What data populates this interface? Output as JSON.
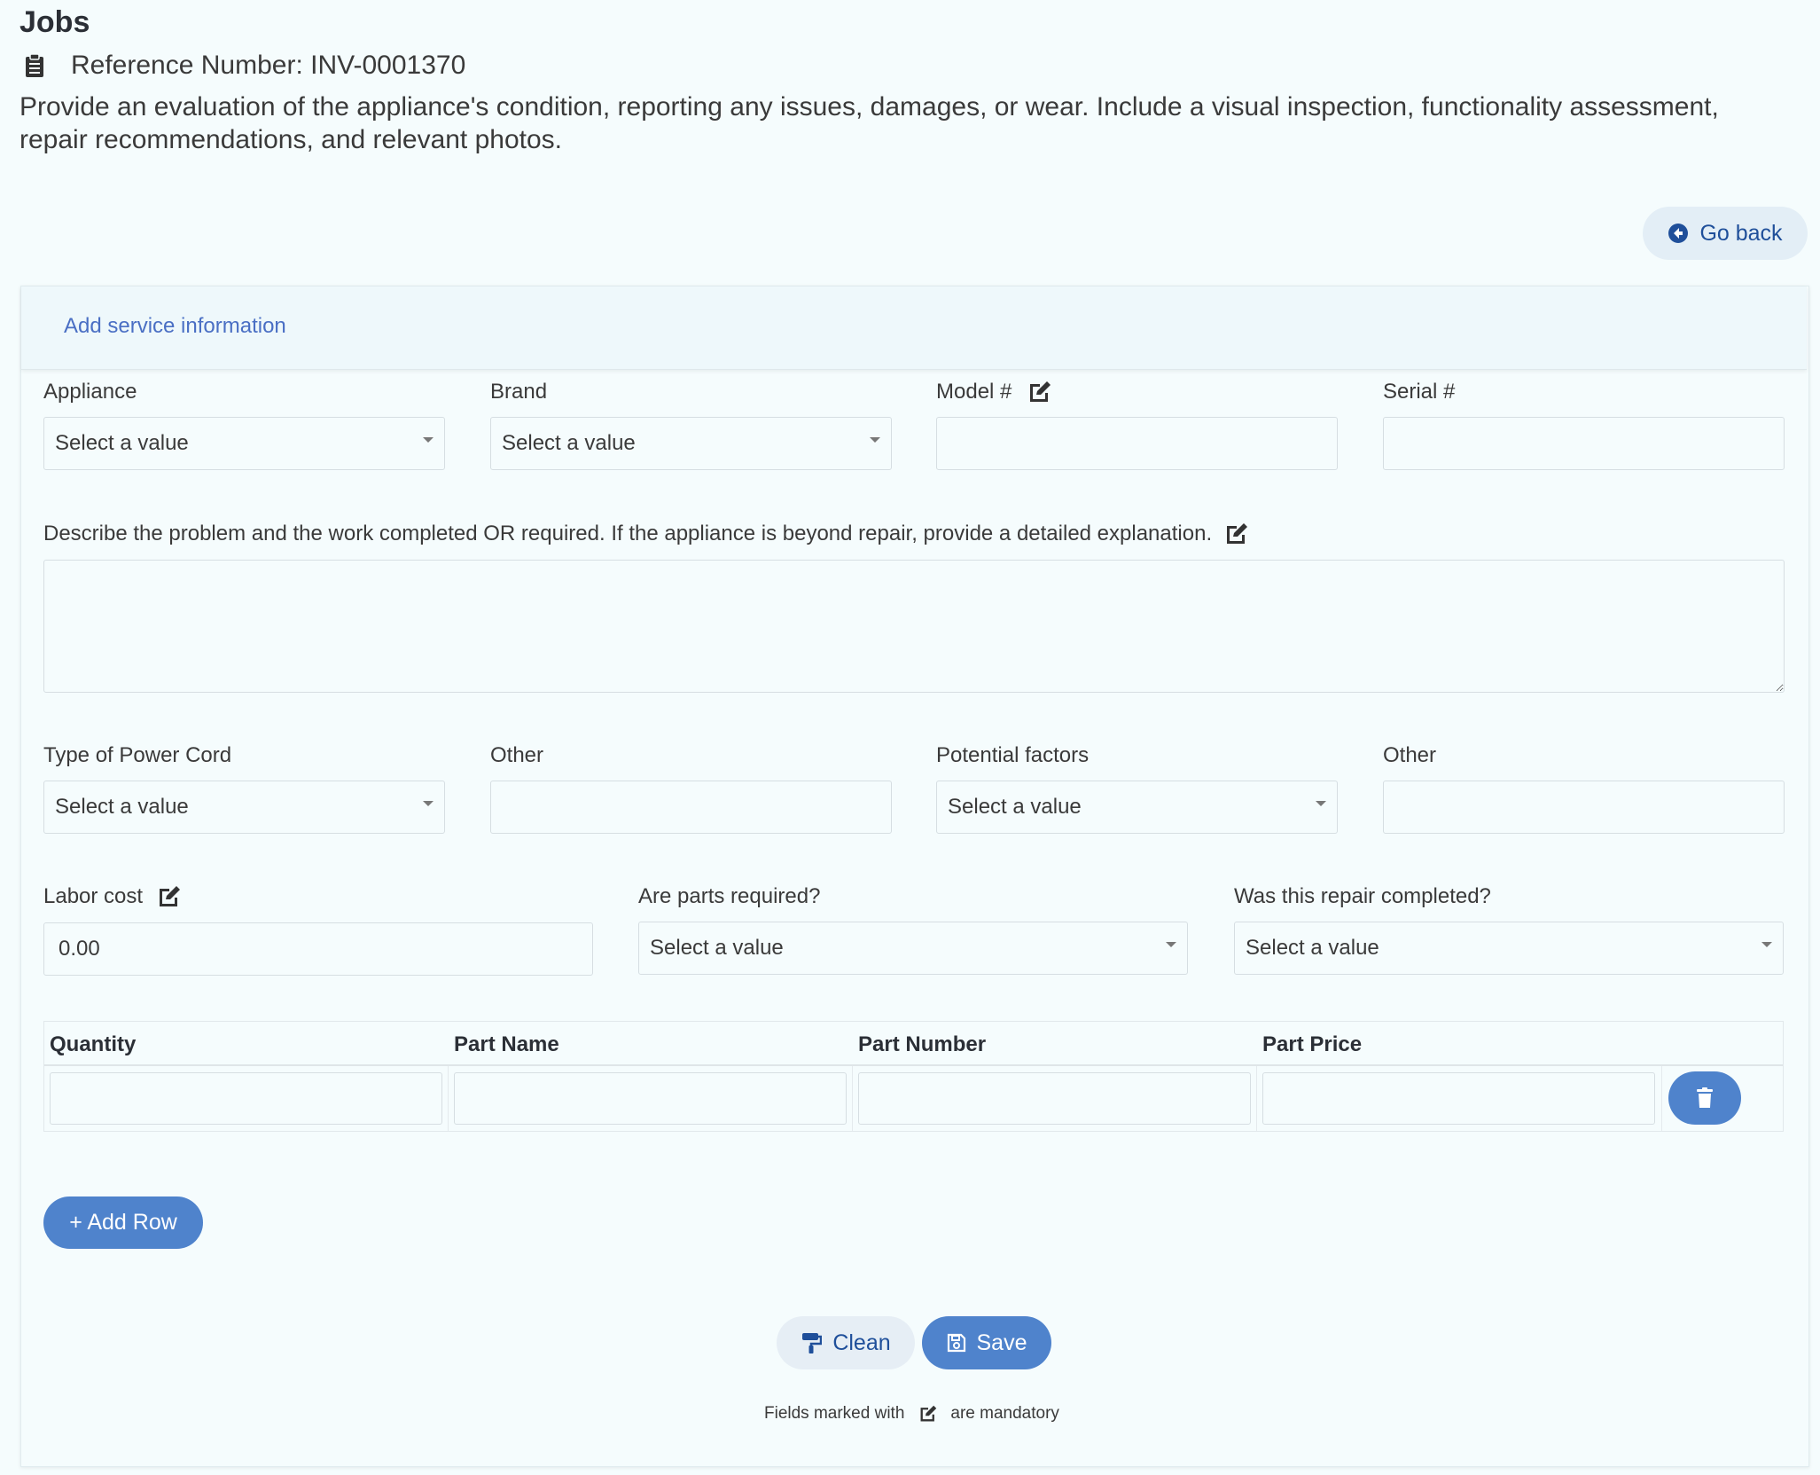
{
  "header": {
    "title": "Jobs",
    "reference_label": "Reference Number: INV-0001370",
    "description": "Provide an evaluation of the appliance's condition, reporting any issues, damages, or wear. Include a visual inspection, functionality assessment, repair recommendations, and relevant photos."
  },
  "go_back_label": "Go back",
  "card": {
    "header_label": "Add service information"
  },
  "form": {
    "appliance": {
      "label": "Appliance",
      "value": "Select a value"
    },
    "brand": {
      "label": "Brand",
      "value": "Select a value"
    },
    "model": {
      "label": "Model #",
      "value": ""
    },
    "serial": {
      "label": "Serial #",
      "value": ""
    },
    "problem": {
      "label": "Describe the problem and the work completed OR required. If the appliance is beyond repair, provide a detailed explanation.",
      "value": ""
    },
    "power_cord": {
      "label": "Type of Power Cord",
      "value": "Select a value"
    },
    "power_cord_other": {
      "label": "Other",
      "value": ""
    },
    "potential_factors": {
      "label": "Potential factors",
      "value": "Select a value"
    },
    "potential_factors_other": {
      "label": "Other",
      "value": ""
    },
    "labor_cost": {
      "label": "Labor cost",
      "value": "0.00"
    },
    "parts_required": {
      "label": "Are parts required?",
      "value": "Select a value"
    },
    "repair_completed": {
      "label": "Was this repair completed?",
      "value": "Select a value"
    }
  },
  "parts_table": {
    "columns": [
      "Quantity",
      "Part Name",
      "Part Number",
      "Part Price"
    ],
    "rows": [
      [
        "",
        "",
        "",
        ""
      ]
    ]
  },
  "buttons": {
    "add_row": "+ Add Row",
    "clean": "Clean",
    "save": "Save"
  },
  "footnote": {
    "prefix": "Fields marked with",
    "suffix": "are mandatory"
  },
  "colors": {
    "background": "#f5fcfd",
    "primary": "#4f83cc",
    "link": "#4a6fc4",
    "secondary_button": "#e6eef5"
  },
  "icons": [
    "clipboard-icon",
    "arrow-circle-left-icon",
    "edit-icon",
    "trash-icon",
    "paint-roller-icon",
    "save-icon"
  ]
}
